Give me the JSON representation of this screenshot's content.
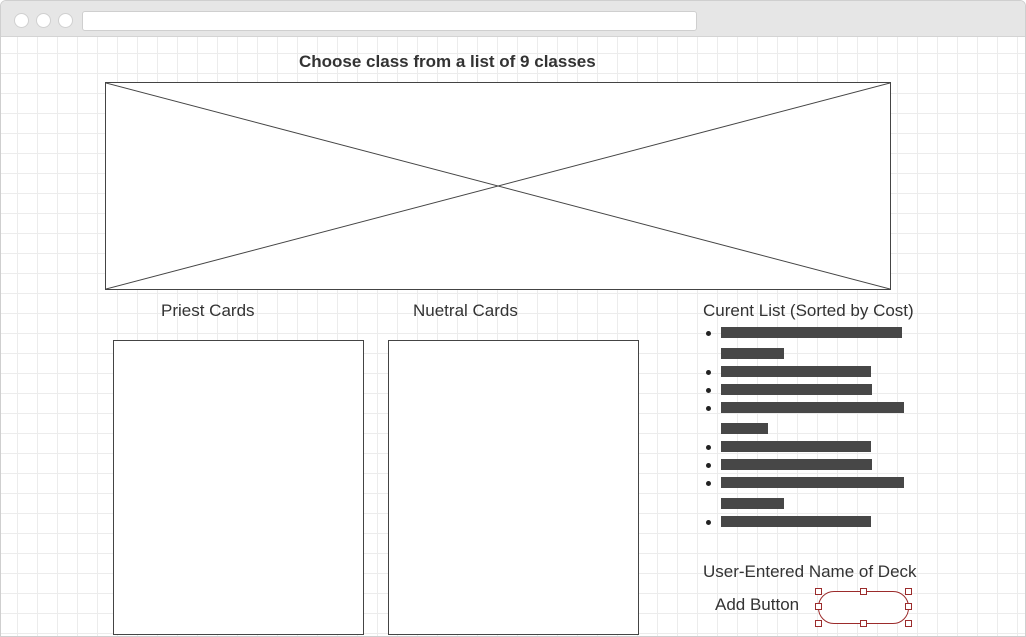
{
  "header": {
    "title": "Choose class from a list of 9 classes"
  },
  "sections": {
    "priest_label": "Priest Cards",
    "neutral_label": "Nuetral Cards",
    "current_list_label": "Curent List (Sorted by Cost)"
  },
  "current_list": {
    "item_count": 8,
    "item_bars": [
      [
        1
      ],
      [
        1
      ],
      [
        1
      ],
      [
        1
      ],
      [
        1
      ],
      [
        1
      ],
      [
        1
      ],
      [
        1
      ]
    ]
  },
  "deck": {
    "name_label": "User-Entered Name of Deck",
    "add_button_label": "Add Button"
  },
  "icons": {
    "image_placeholder": "image-placeholder-icon",
    "window_controls": "window-dot-icon"
  },
  "colors": {
    "text": "#333333",
    "bar": "#474747",
    "selection": "#9b2b2b",
    "grid": "#ececec"
  }
}
